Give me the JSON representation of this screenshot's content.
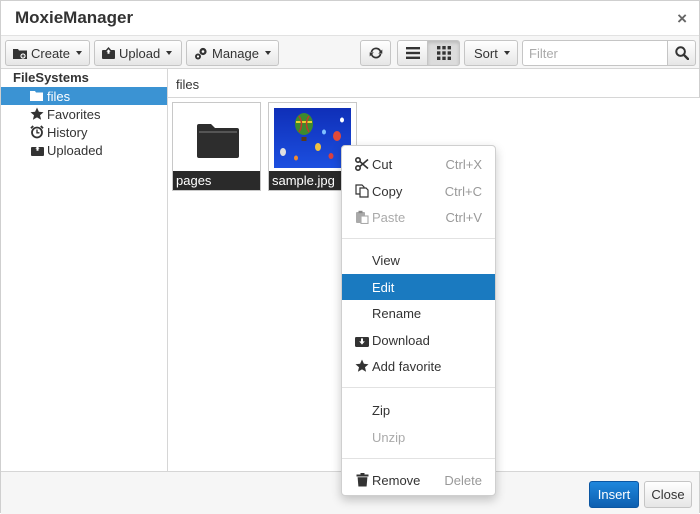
{
  "window": {
    "title": "MoxieManager",
    "close_glyph": "×"
  },
  "toolbar": {
    "create_label": "Create",
    "upload_label": "Upload",
    "manage_label": "Manage",
    "sort_label": "Sort",
    "filter_placeholder": "Filter",
    "view_mode": "thumbnails"
  },
  "sidebar": {
    "title": "FileSystems",
    "items": [
      {
        "label": "files",
        "icon": "folder-open-icon",
        "selected": true
      },
      {
        "label": "Favorites",
        "icon": "star-icon",
        "selected": false
      },
      {
        "label": "History",
        "icon": "alarm-clock-icon",
        "selected": false
      },
      {
        "label": "Uploaded",
        "icon": "upload-box-icon",
        "selected": false
      }
    ]
  },
  "path": {
    "current": "files"
  },
  "files": [
    {
      "name": "pages",
      "type": "folder"
    },
    {
      "name": "sample.jpg",
      "type": "image"
    }
  ],
  "context_menu": {
    "items": [
      {
        "label": "Cut",
        "shortcut": "Ctrl+X",
        "icon": "scissors-icon",
        "enabled": true
      },
      {
        "label": "Copy",
        "shortcut": "Ctrl+C",
        "icon": "copy-icon",
        "enabled": true
      },
      {
        "label": "Paste",
        "shortcut": "Ctrl+V",
        "icon": "paste-icon",
        "enabled": false
      },
      {
        "label": "View",
        "shortcut": "",
        "icon": "",
        "enabled": true
      },
      {
        "label": "Edit",
        "shortcut": "",
        "icon": "",
        "enabled": true,
        "highlighted": true
      },
      {
        "label": "Rename",
        "shortcut": "",
        "icon": "",
        "enabled": true
      },
      {
        "label": "Download",
        "shortcut": "",
        "icon": "download-icon",
        "enabled": true
      },
      {
        "label": "Add favorite",
        "shortcut": "",
        "icon": "star-icon",
        "enabled": true
      },
      {
        "label": "Zip",
        "shortcut": "",
        "icon": "",
        "enabled": true
      },
      {
        "label": "Unzip",
        "shortcut": "",
        "icon": "",
        "enabled": false
      },
      {
        "label": "Remove",
        "shortcut": "Delete",
        "icon": "trash-icon",
        "enabled": true
      }
    ]
  },
  "footer": {
    "insert_label": "Insert",
    "close_label": "Close"
  },
  "colors": {
    "selection": "#3b93d3",
    "menu_highlight": "#1a7ac0",
    "primary_button": "#1470c4"
  }
}
